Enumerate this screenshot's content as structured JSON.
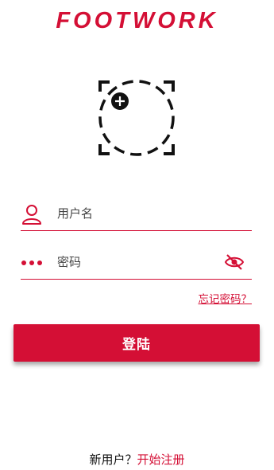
{
  "brand": {
    "logo_text": "FOOTWORK",
    "accent_color": "#d40f35"
  },
  "avatar": {
    "icon": "camera-focus-add-icon"
  },
  "login_form": {
    "username_placeholder": "用户名",
    "password_placeholder": "密码",
    "username_icon": "user-icon",
    "password_icon": "dots-icon",
    "toggle_visibility_icon": "eye-off-icon",
    "forgot_password_label": "忘记密码？",
    "login_button_label": "登陆"
  },
  "footer": {
    "new_user_label": "新用户？",
    "register_label": "开始注册"
  }
}
